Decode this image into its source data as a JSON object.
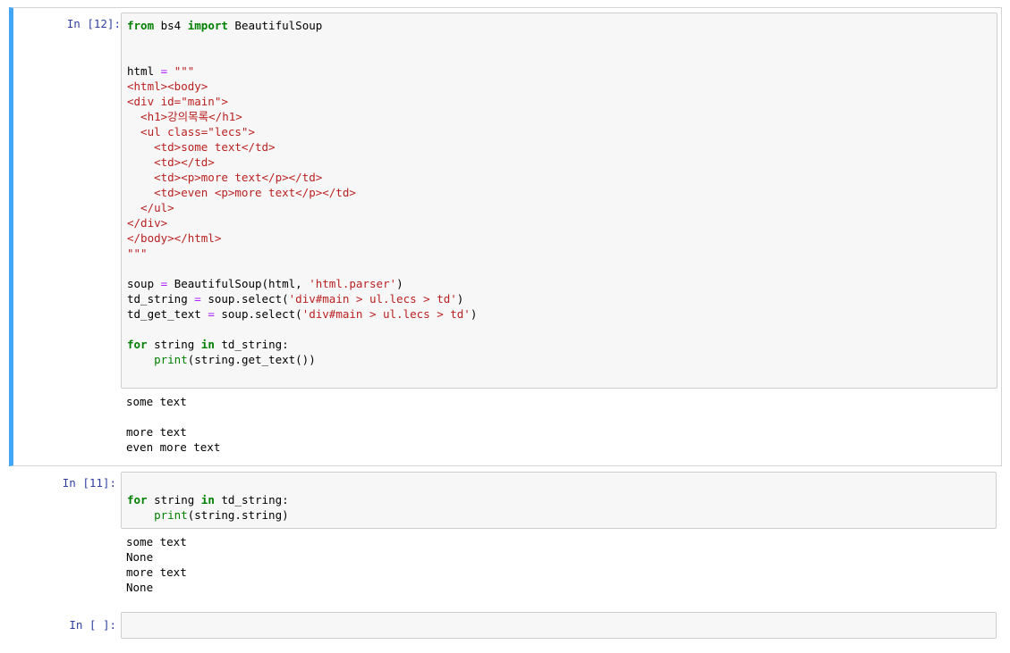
{
  "cells": [
    {
      "prompt": "In [12]:",
      "code": {
        "l1_kw1": "from",
        "l1_mod": " bs4 ",
        "l1_kw2": "import",
        "l1_rest": " BeautifulSoup",
        "l4_var": "html ",
        "l4_eq": "=",
        "l4_str": " \"\"\"",
        "l5": "<html><body>",
        "l6": "<div id=\"main\">",
        "l7": "  <h1>강의목록</h1>",
        "l8": "  <ul class=\"lecs\">",
        "l9": "    <td>some text</td>",
        "l10": "    <td></td>",
        "l11": "    <td><p>more text</p></td>",
        "l12": "    <td>even <p>more text</p></td>",
        "l13": "  </ul>",
        "l14": "</div>",
        "l15": "</body></html>",
        "l16": "\"\"\"",
        "l18_a": "soup ",
        "l18_eq": "=",
        "l18_b": " BeautifulSoup(html, ",
        "l18_str": "'html.parser'",
        "l18_c": ")",
        "l19_a": "td_string ",
        "l19_eq": "=",
        "l19_b": " soup.select(",
        "l19_str": "'div#main > ul.lecs > td'",
        "l19_c": ")",
        "l20_a": "td_get_text ",
        "l20_eq": "=",
        "l20_b": " soup.select(",
        "l20_str": "'div#main > ul.lecs > td'",
        "l20_c": ")",
        "l22_kw1": "for",
        "l22_a": " string ",
        "l22_kw2": "in",
        "l22_b": " td_string:",
        "l23_indent": "    ",
        "l23_fn": "print",
        "l23_rest": "(string.get_text())"
      },
      "output": [
        "some text",
        "",
        "more text",
        "even more text"
      ]
    },
    {
      "prompt": "In [11]:",
      "code": {
        "l1_kw1": "for",
        "l1_a": " string ",
        "l1_kw2": "in",
        "l1_b": " td_string:",
        "l2_indent": "    ",
        "l2_fn": "print",
        "l2_rest": "(string.string)"
      },
      "output": [
        "some text",
        "None",
        "more text",
        "None"
      ]
    },
    {
      "prompt": "In [ ]:"
    }
  ],
  "colors": {
    "prompt": "#303f9f",
    "selected_bar": "#42a5f5",
    "keyword": "#008000",
    "string": "#ba2121",
    "operator": "#aa22ff"
  }
}
